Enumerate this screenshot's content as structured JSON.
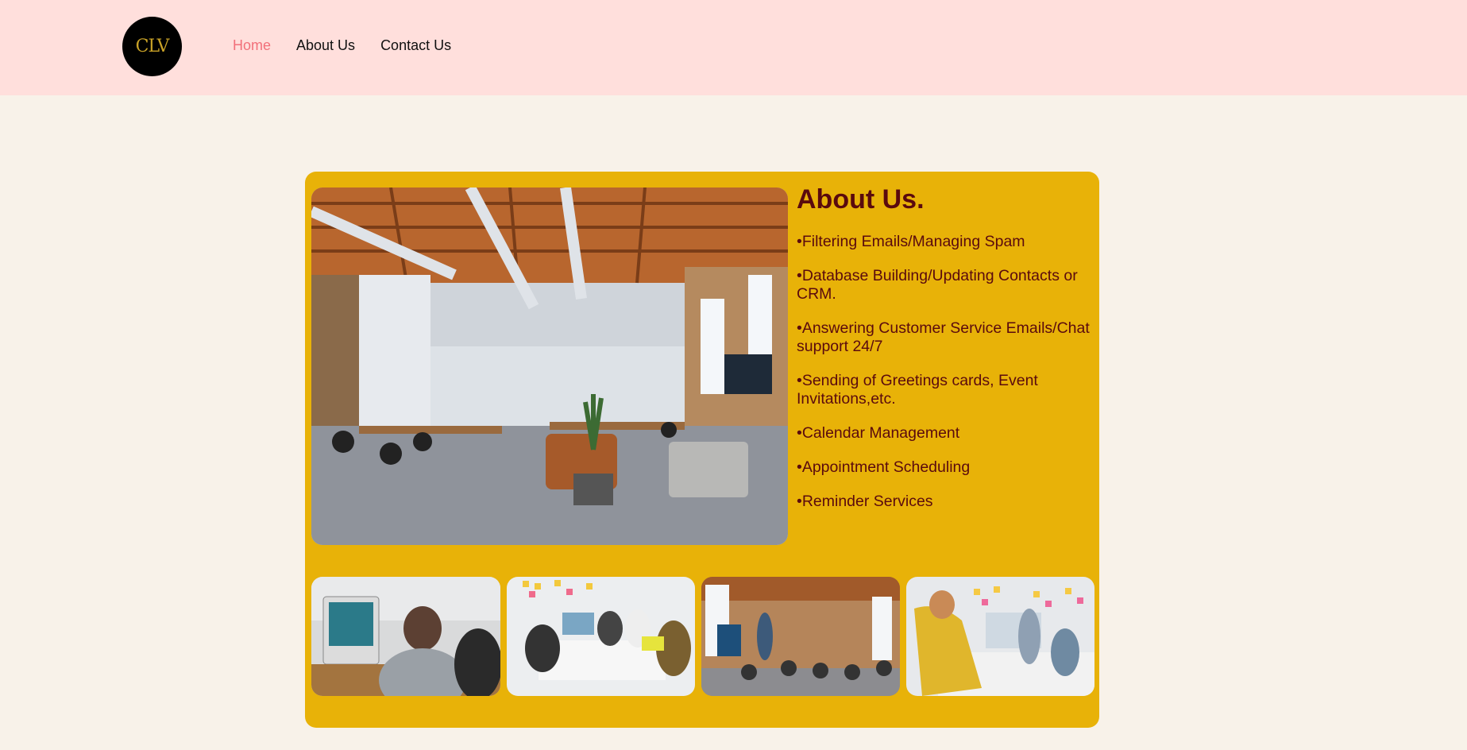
{
  "logo": {
    "text": "CLV"
  },
  "nav": {
    "items": [
      {
        "label": "Home",
        "active": true
      },
      {
        "label": "About Us",
        "active": false
      },
      {
        "label": "Contact Us",
        "active": false
      }
    ]
  },
  "about": {
    "title": "About Us.",
    "items": [
      "•Filtering Emails/Managing Spam",
      "•Database Building/Updating Contacts or CRM.",
      "•Answering Customer Service Emails/Chat support 24/7",
      "•Sending of Greetings cards, Event Invitations,etc.",
      "•Calendar Management",
      "•Appointment Scheduling",
      "•Reminder Services"
    ]
  },
  "colors": {
    "header_bg": "#ffdfdc",
    "page_bg": "#f8f2e9",
    "card_bg": "#e8b208",
    "heading": "#5a0a0e",
    "nav_active": "#f2707a"
  },
  "images": {
    "hero": "office-photo",
    "thumbs": [
      "person-at-computer-photo",
      "team-meeting-photo",
      "office-presentation-photo",
      "collaboration-photo"
    ]
  }
}
